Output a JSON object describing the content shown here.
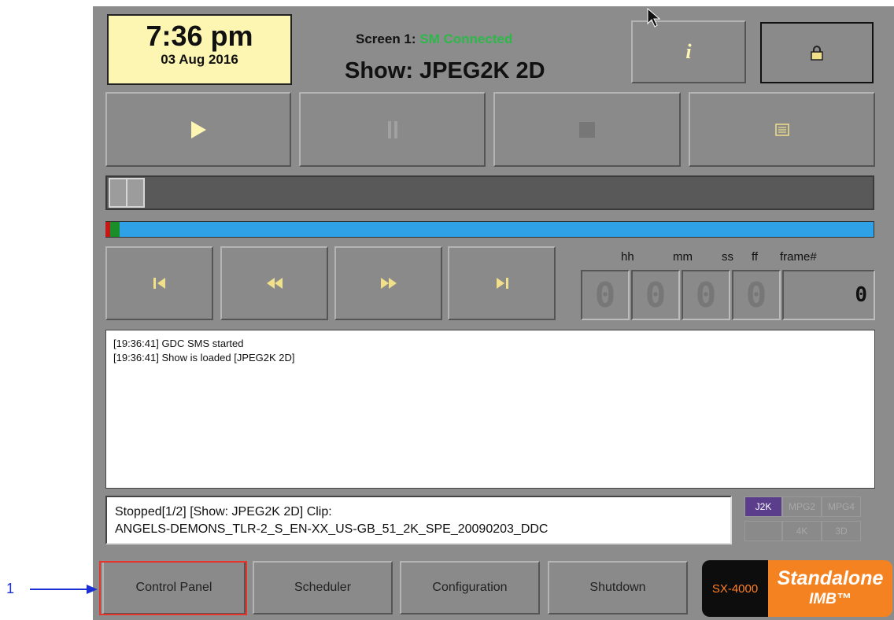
{
  "header": {
    "time": "7:36 pm",
    "date": "03 Aug 2016",
    "screen_label": "Screen 1:",
    "screen_status": "SM Connected",
    "show": "Show: JPEG2K 2D",
    "info_icon": "info-icon",
    "lock_icon": "lock-icon"
  },
  "transport": {
    "play_icon": "play-icon",
    "pause_icon": "pause-icon",
    "stop_icon": "stop-icon",
    "playlist_icon": "playlist-icon"
  },
  "navigation": {
    "prev_icon": "skip-previous-icon",
    "rewind_icon": "rewind-icon",
    "forward_icon": "fast-forward-icon",
    "next_icon": "skip-next-icon"
  },
  "timecode": {
    "labels": [
      "hh",
      "mm",
      "ss",
      "ff",
      "frame#"
    ],
    "digits": [
      "0",
      "0",
      "0",
      "0"
    ],
    "frame": "0"
  },
  "log": {
    "lines": [
      "[19:36:41] GDC SMS started",
      "[19:36:41] Show is loaded [JPEG2K 2D]"
    ]
  },
  "status": {
    "line1": "Stopped[1/2] [Show: JPEG2K 2D] Clip:",
    "line2": "ANGELS-DEMONS_TLR-2_S_EN-XX_US-GB_51_2K_SPE_20090203_DDC"
  },
  "format_badges": {
    "j2k": "J2K",
    "mpg2": "MPG2",
    "mpg4": "MPG4",
    "k4": "4K",
    "threed": "3D"
  },
  "bottom": {
    "control_panel": "Control Panel",
    "scheduler": "Scheduler",
    "configuration": "Configuration",
    "shutdown": "Shutdown"
  },
  "brand": {
    "model": "SX-4000",
    "name": "Standalone",
    "sub": "IMB™"
  },
  "callout": {
    "number": "1"
  },
  "colors": {
    "panel": "#8c8c8c",
    "clock_bg": "#fdf5b2",
    "connected": "#2db84a",
    "progress": "#2fa1e6",
    "j2k_badge": "#5a3e8c",
    "brand_orange": "#f58220",
    "callout_blue": "#1a2fd6",
    "highlight_red": "#e8322c"
  },
  "playback": {
    "position": 0
  }
}
